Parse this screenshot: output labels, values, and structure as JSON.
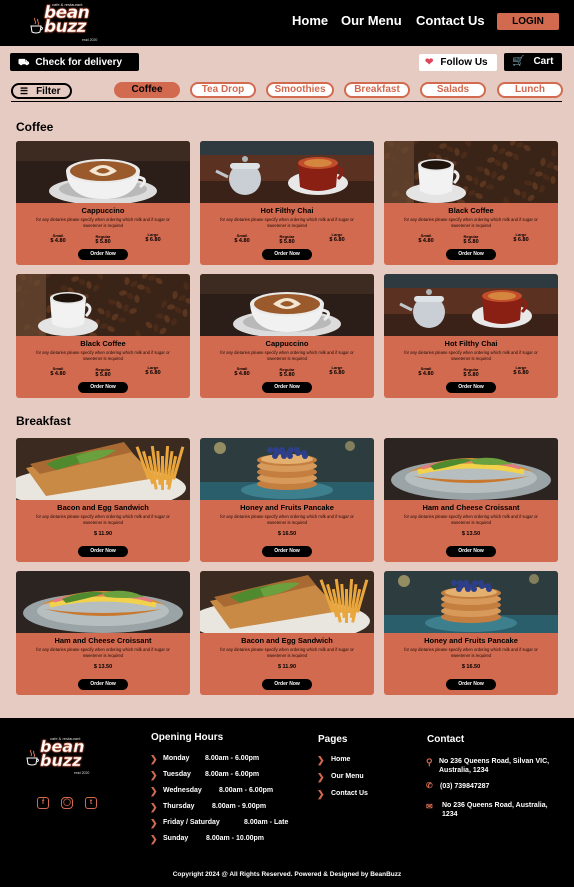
{
  "header": {
    "logo_tagline": "cafe & restaurant",
    "logo_word": "bean buzz",
    "logo_est": "estd 2020",
    "nav": [
      "Home",
      "Our Menu",
      "Contact Us"
    ],
    "login": "LOGIN"
  },
  "actions": {
    "delivery": "Check for delivery",
    "follow": "Follow Us",
    "cart": "Cart",
    "filter": "Filter"
  },
  "categories": [
    "Coffee",
    "Tea Drop",
    "Smoothies",
    "Breakfast",
    "Salads",
    "Lunch"
  ],
  "active_category": "Coffee",
  "sections": {
    "coffee_title": "Coffee",
    "breakfast_title": "Breakfast"
  },
  "common": {
    "desc": "for any dietaries please specify when ordering which milk and if sugar or sweetener is required",
    "order": "Order Now",
    "size_small": "Small",
    "size_regular": "Regular",
    "size_large": "Large"
  },
  "coffee_items": [
    {
      "name": "Cappuccino",
      "small": "$ 4.80",
      "regular": "$ 5.80",
      "large": "$ 6.80",
      "image": "latte-art-photo"
    },
    {
      "name": "Hot Filthy Chai",
      "small": "$ 4.80",
      "regular": "$ 5.80",
      "large": "$ 6.80",
      "image": "chai-teapot-photo"
    },
    {
      "name": "Black Coffee",
      "small": "$ 4.80",
      "regular": "$ 5.80",
      "large": "$ 6.80",
      "image": "black-coffee-beans-photo"
    },
    {
      "name": "Black Coffee",
      "small": "$ 4.80",
      "regular": "$ 5.80",
      "large": "$ 6.80",
      "image": "black-coffee-beans-photo"
    },
    {
      "name": "Cappuccino",
      "small": "$ 4.80",
      "regular": "$ 5.80",
      "large": "$ 6.80",
      "image": "latte-art-photo"
    },
    {
      "name": "Hot Filthy Chai",
      "small": "$ 4.80",
      "regular": "$ 5.80",
      "large": "$ 6.80",
      "image": "chai-teapot-photo"
    }
  ],
  "breakfast_items": [
    {
      "name": "Bacon and Egg Sandwich",
      "price": "$ 11.90",
      "image": "sandwich-fries-photo"
    },
    {
      "name": "Honey and Fruits Pancake",
      "price": "$ 16.50",
      "image": "pancake-blueberry-photo"
    },
    {
      "name": "Ham and Cheese Croissant",
      "price": "$ 13.50",
      "image": "croissant-photo"
    },
    {
      "name": "Ham and Cheese Croissant",
      "price": "$ 13.50",
      "image": "croissant-photo"
    },
    {
      "name": "Bacon and Egg Sandwich",
      "price": "$ 11.90",
      "image": "sandwich-fries-photo"
    },
    {
      "name": "Honey and Fruits Pancake",
      "price": "$ 16.50",
      "image": "pancake-blueberry-photo"
    }
  ],
  "footer": {
    "hours_title": "Opening Hours",
    "hours": [
      {
        "day": "Monday",
        "time": "8.00am  -  6.00pm"
      },
      {
        "day": "Tuesday",
        "time": "8.00am  -  6.00pm"
      },
      {
        "day": "Wednesday",
        "time": "8.00am  -  6.00pm"
      },
      {
        "day": "Thursday",
        "time": "8.00am  -  9.00pm"
      },
      {
        "day": "Friday  /   Saturday",
        "time": "8.00am  -  Late"
      },
      {
        "day": "Sunday",
        "time": "8.00am  -  10.00pm"
      }
    ],
    "pages_title": "Pages",
    "pages": [
      "Home",
      "Our Menu",
      "Contact Us"
    ],
    "contact_title": "Contact",
    "address": "No 236 Queens Road, Silvan VIC, Australia, 1234",
    "phone": "(03) 739847287",
    "email": "No 236 Queens Road,  Australia, 1234",
    "copyright": "Copyright 2024 @ All Rights Reserved. Powered & Designed by BeanBuzz"
  },
  "colors": {
    "accent": "#d26a4f",
    "background": "#e6cbc3",
    "header": "#000000"
  }
}
